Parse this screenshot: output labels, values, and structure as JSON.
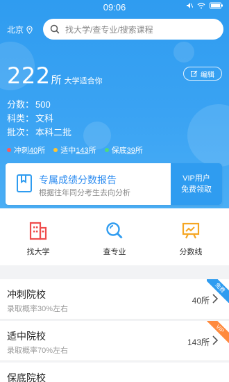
{
  "status": {
    "time": "09:06"
  },
  "header": {
    "city": "北京",
    "search_placeholder": "找大学/查专业/搜索课程"
  },
  "summary": {
    "count": "222",
    "unit": "所",
    "suffix": "大学适合你",
    "edit_label": "编辑",
    "score_label": "分数：",
    "score": "500",
    "subject_label": "科类：",
    "subject": "文科",
    "batch_label": "批次：",
    "batch": "本科二批"
  },
  "legend": [
    {
      "prefix": "冲刺",
      "count": "40",
      "suffix": "所",
      "color": "#ff5a5a"
    },
    {
      "prefix": "适中",
      "count": "143",
      "suffix": "所",
      "color": "#ffc531"
    },
    {
      "prefix": "保底",
      "count": "39",
      "suffix": "所",
      "color": "#4fd97c"
    }
  ],
  "report": {
    "title": "专属成绩分数报告",
    "subtitle": "根据往年同分考生去向分析",
    "vip_line1": "VIP用户",
    "vip_line2": "免费领取"
  },
  "quick": [
    {
      "label": "找大学",
      "icon": "building-icon"
    },
    {
      "label": "查专业",
      "icon": "search-magnifier-icon"
    },
    {
      "label": "分数线",
      "icon": "chart-board-icon"
    }
  ],
  "rows": [
    {
      "title": "冲刺院校",
      "subtitle": "录取概率30%左右",
      "count": "40所",
      "ribbon": "免费",
      "ribbon_color": "#2f9cf0"
    },
    {
      "title": "适中院校",
      "subtitle": "录取概率70%左右",
      "count": "143所",
      "ribbon": "VIP",
      "ribbon_color": "#ff8a3d"
    }
  ],
  "partial_row": {
    "title": "保底院校"
  }
}
